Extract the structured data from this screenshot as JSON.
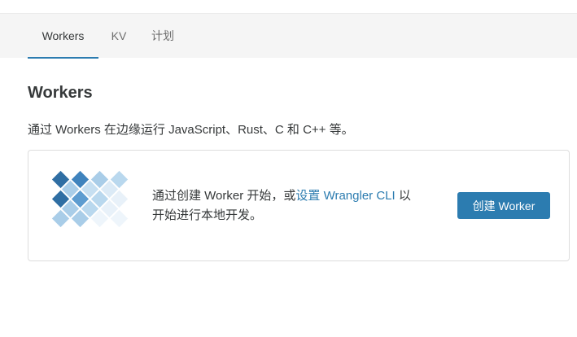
{
  "tabs": [
    {
      "label": "Workers",
      "active": true
    },
    {
      "label": "KV",
      "active": false
    },
    {
      "label": "计划",
      "active": false
    }
  ],
  "main": {
    "title": "Workers",
    "description": "通过 Workers 在边缘运行 JavaScript、Rust、C 和 C++ 等。"
  },
  "card": {
    "illustration_icon": "workers-diamond-grid-icon",
    "text_prefix": "通过创建 Worker 开始，或",
    "link_text": "设置 Wrangler CLI",
    "text_suffix": " 以开始进行本地开发。",
    "button_label": "创建 Worker"
  },
  "colors": {
    "accent": "#2c7cb0",
    "tabbar_bg": "#f5f5f5",
    "text": "#36393a"
  }
}
